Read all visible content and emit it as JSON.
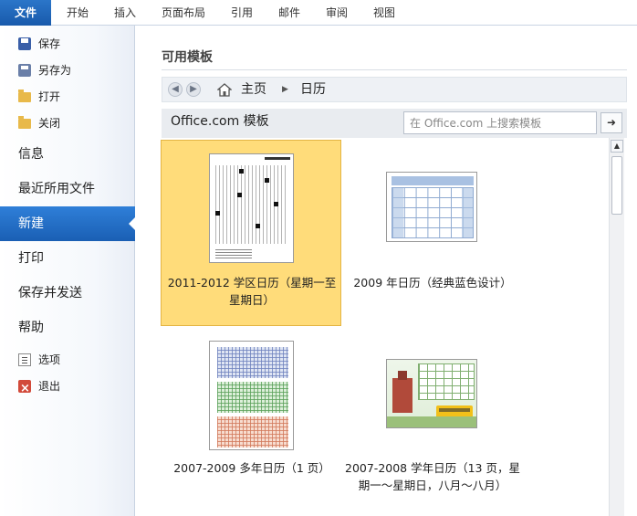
{
  "ribbon": {
    "tabs": [
      "文件",
      "开始",
      "插入",
      "页面布局",
      "引用",
      "邮件",
      "审阅",
      "视图"
    ]
  },
  "nav": {
    "save": "保存",
    "save_as": "另存为",
    "open": "打开",
    "close": "关闭",
    "info": "信息",
    "recent": "最近所用文件",
    "new": "新建",
    "print": "打印",
    "save_send": "保存并发送",
    "help": "帮助",
    "options": "选项",
    "exit": "退出"
  },
  "main": {
    "section_title": "可用模板",
    "breadcrumb": {
      "home": "主页",
      "current": "日历"
    },
    "office_label": "Office.com 模板",
    "search_placeholder": "在 Office.com 上搜索模板",
    "go_glyph": "➜"
  },
  "templates": [
    {
      "label": "2011-2012 学区日历（星期一至星期日）",
      "selected": true
    },
    {
      "label": "2009 年日历（经典蓝色设计）",
      "selected": false
    },
    {
      "label": "2007-2009 多年日历（1 页）",
      "selected": false
    },
    {
      "label": "2007-2008 学年日历（13 页，星期一～星期日，八月～八月）",
      "selected": false
    }
  ],
  "colors": {
    "file_tab": "#1e63b6",
    "nav_active": "#2470c8",
    "selected_tile": "#ffdc7a"
  }
}
